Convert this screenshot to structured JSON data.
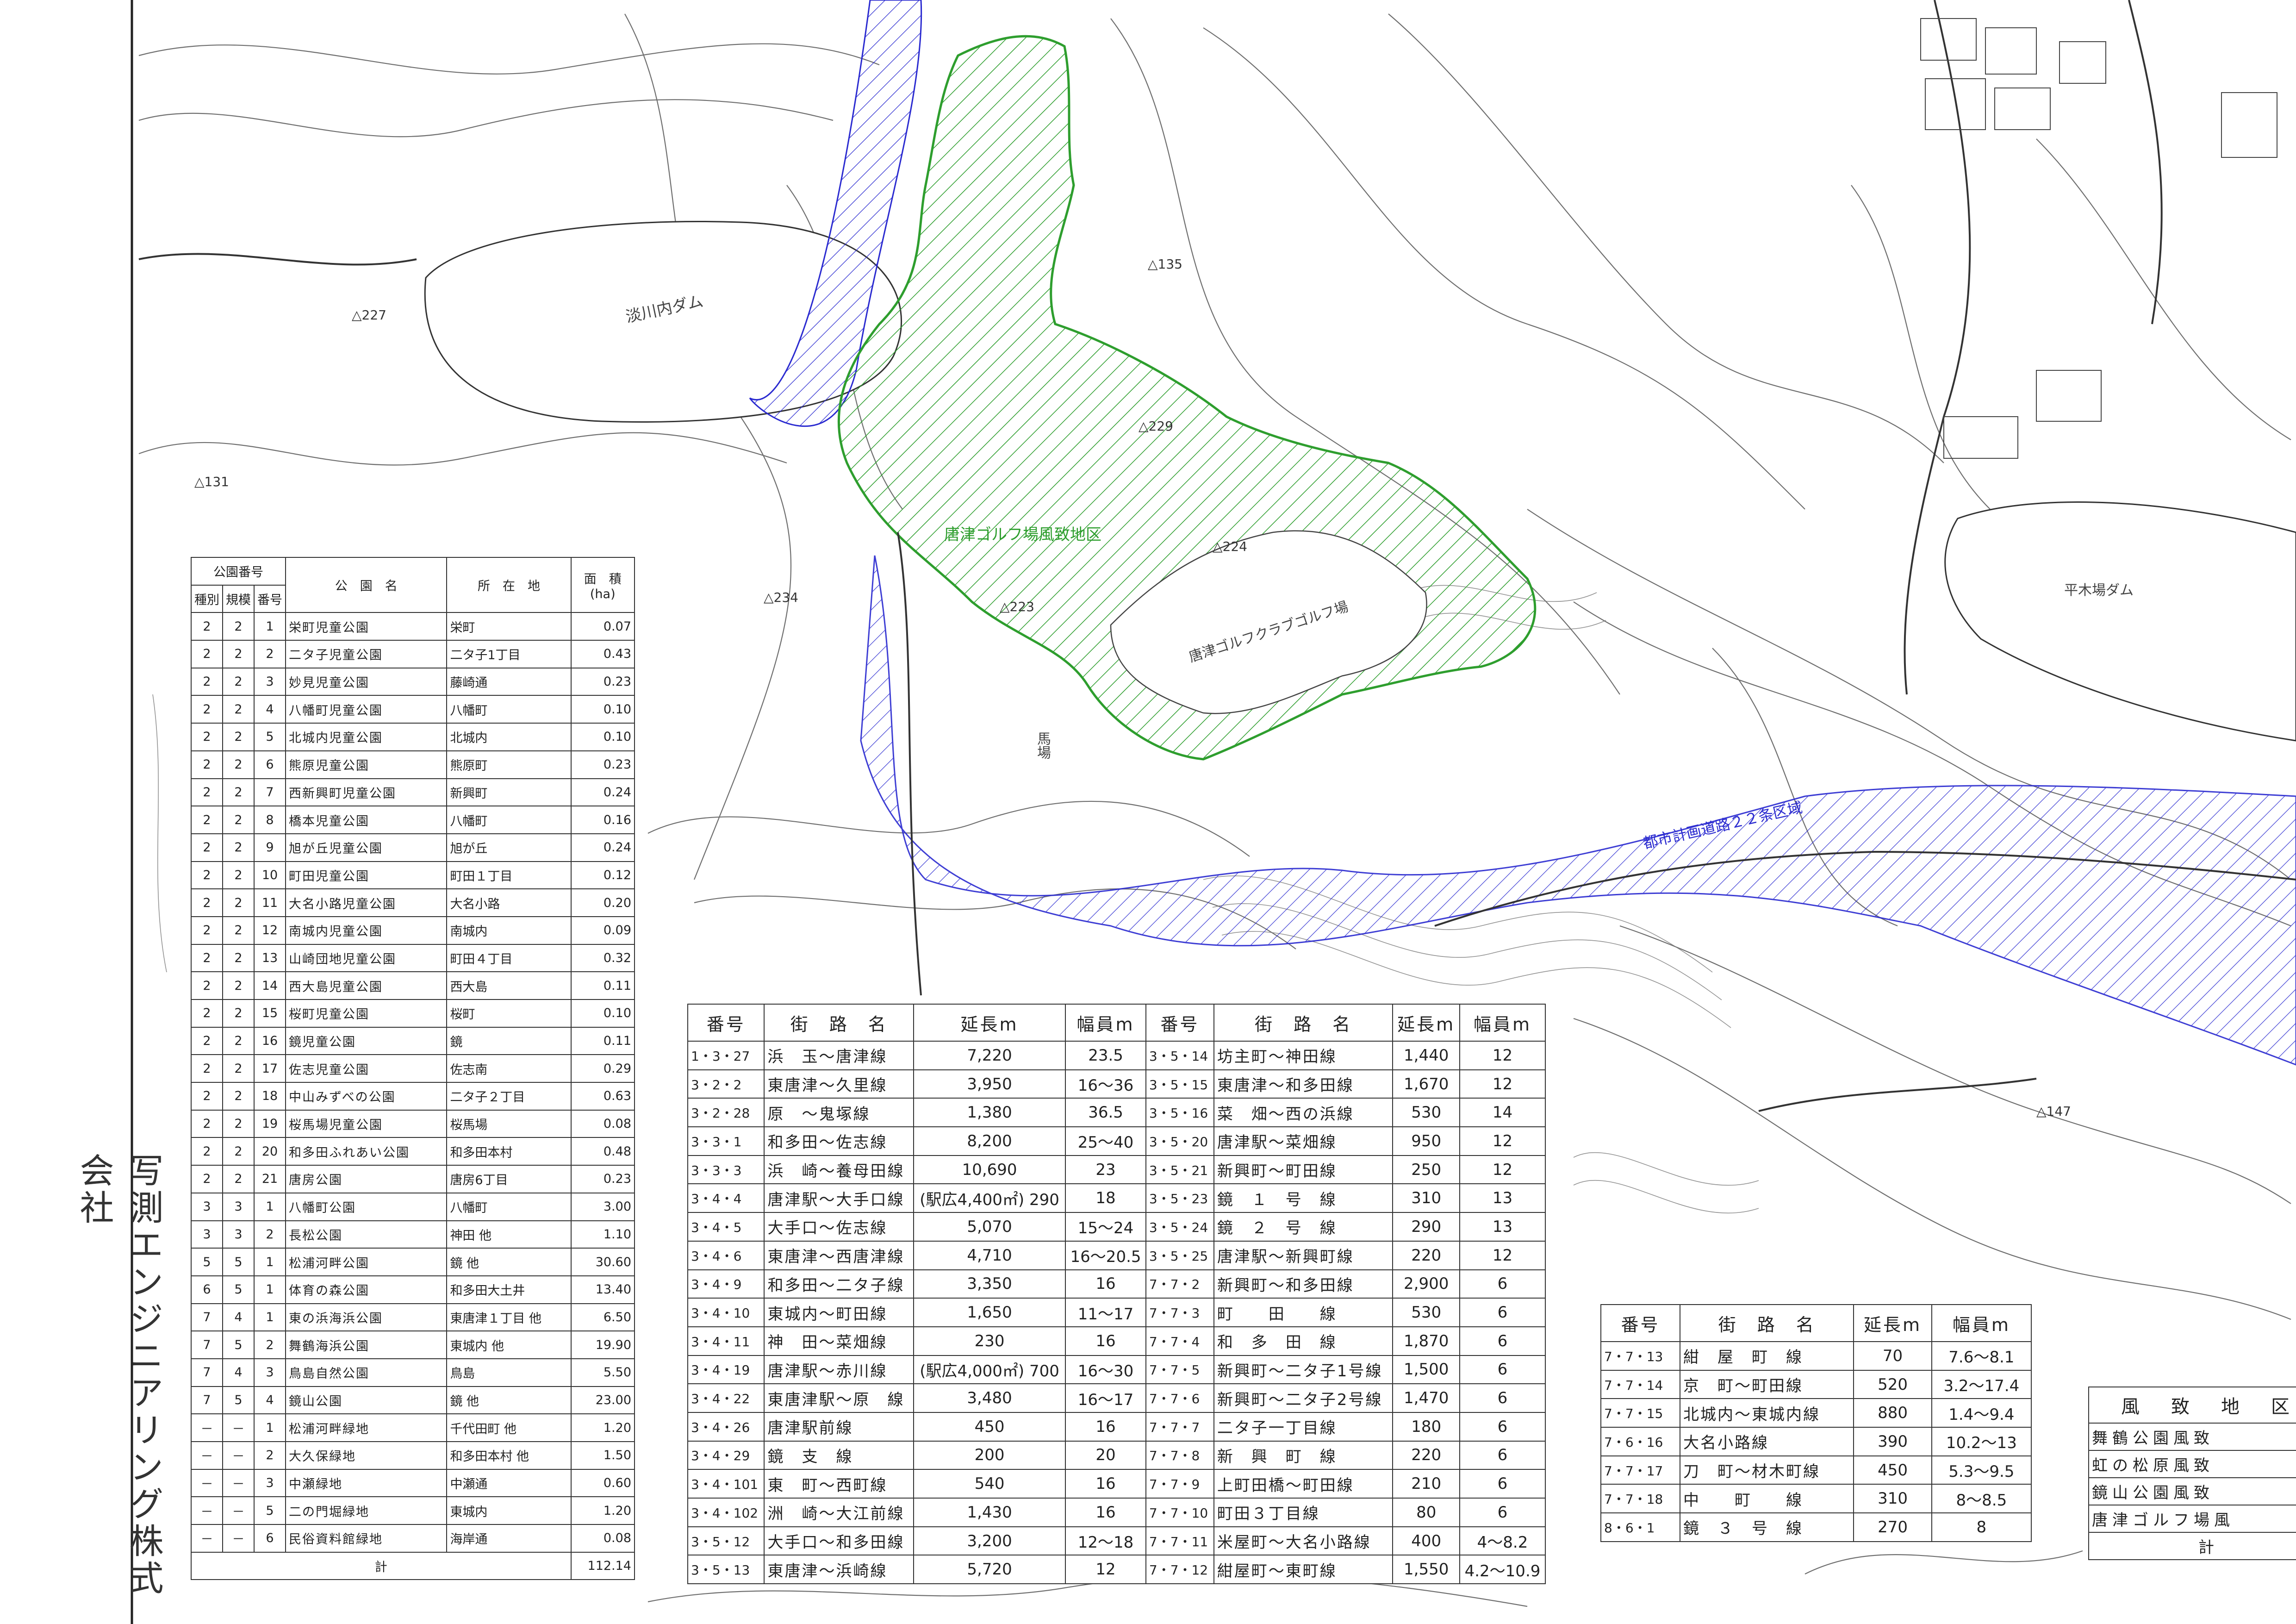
{
  "vertical_text": "写測エンジニアリング株式会社",
  "map_labels": {
    "golf_zone": "唐津ゴルフ場風致地区",
    "dam_left": "淡川内ダム",
    "dam_right": "平木場ダム",
    "golf_course": "唐津ゴルフクラブゴルフ場",
    "road_zone": "都市計画道路２２条区域",
    "horse_track": "馬場",
    "elevations": [
      "227",
      "223",
      "229",
      "224",
      "234",
      "131",
      "135",
      "147"
    ],
    "colors": {
      "golf_zone": "#2e9e2e",
      "road_zone": "#2a2ad0",
      "contour": "#555555"
    }
  },
  "park_table": {
    "header_group": "公園番号",
    "headers": {
      "type": "種別",
      "scale": "規模",
      "no": "番号",
      "name": "公　園　名",
      "location": "所　在　地",
      "area": "面　積",
      "area_unit": "(ha)"
    },
    "rows": [
      {
        "type": "2",
        "scale": "2",
        "no": "1",
        "name": "栄町児童公園",
        "loc": "栄町",
        "area": "0.07"
      },
      {
        "type": "2",
        "scale": "2",
        "no": "2",
        "name": "二タ子児童公園",
        "loc": "二タ子1丁目",
        "area": "0.43"
      },
      {
        "type": "2",
        "scale": "2",
        "no": "3",
        "name": "妙見児童公園",
        "loc": "藤崎通",
        "area": "0.23"
      },
      {
        "type": "2",
        "scale": "2",
        "no": "4",
        "name": "八幡町児童公園",
        "loc": "八幡町",
        "area": "0.10"
      },
      {
        "type": "2",
        "scale": "2",
        "no": "5",
        "name": "北城内児童公園",
        "loc": "北城内",
        "area": "0.10"
      },
      {
        "type": "2",
        "scale": "2",
        "no": "6",
        "name": "熊原児童公園",
        "loc": "熊原町",
        "area": "0.23"
      },
      {
        "type": "2",
        "scale": "2",
        "no": "7",
        "name": "西新興町児童公園",
        "loc": "新興町",
        "area": "0.24"
      },
      {
        "type": "2",
        "scale": "2",
        "no": "8",
        "name": "橋本児童公園",
        "loc": "八幡町",
        "area": "0.16"
      },
      {
        "type": "2",
        "scale": "2",
        "no": "9",
        "name": "旭が丘児童公園",
        "loc": "旭が丘",
        "area": "0.24"
      },
      {
        "type": "2",
        "scale": "2",
        "no": "10",
        "name": "町田児童公園",
        "loc": "町田１丁目",
        "area": "0.12"
      },
      {
        "type": "2",
        "scale": "2",
        "no": "11",
        "name": "大名小路児童公園",
        "loc": "大名小路",
        "area": "0.20"
      },
      {
        "type": "2",
        "scale": "2",
        "no": "12",
        "name": "南城内児童公園",
        "loc": "南城内",
        "area": "0.09"
      },
      {
        "type": "2",
        "scale": "2",
        "no": "13",
        "name": "山崎団地児童公園",
        "loc": "町田４丁目",
        "area": "0.32"
      },
      {
        "type": "2",
        "scale": "2",
        "no": "14",
        "name": "西大島児童公園",
        "loc": "西大島",
        "area": "0.11"
      },
      {
        "type": "2",
        "scale": "2",
        "no": "15",
        "name": "桜町児童公園",
        "loc": "桜町",
        "area": "0.10"
      },
      {
        "type": "2",
        "scale": "2",
        "no": "16",
        "name": "鏡児童公園",
        "loc": "鏡",
        "area": "0.11"
      },
      {
        "type": "2",
        "scale": "2",
        "no": "17",
        "name": "佐志児童公園",
        "loc": "佐志南",
        "area": "0.29"
      },
      {
        "type": "2",
        "scale": "2",
        "no": "18",
        "name": "中山みずべの公園",
        "loc": "二タ子２丁目",
        "area": "0.63"
      },
      {
        "type": "2",
        "scale": "2",
        "no": "19",
        "name": "桜馬場児童公園",
        "loc": "桜馬場",
        "area": "0.08"
      },
      {
        "type": "2",
        "scale": "2",
        "no": "20",
        "name": "和多田ふれあい公園",
        "loc": "和多田本村",
        "area": "0.48"
      },
      {
        "type": "2",
        "scale": "2",
        "no": "21",
        "name": "唐房公園",
        "loc": "唐房6丁目",
        "area": "0.23"
      },
      {
        "type": "3",
        "scale": "3",
        "no": "1",
        "name": "八幡町公園",
        "loc": "八幡町",
        "area": "3.00"
      },
      {
        "type": "3",
        "scale": "3",
        "no": "2",
        "name": "長松公園",
        "loc": "神田 他",
        "area": "1.10"
      },
      {
        "type": "5",
        "scale": "5",
        "no": "1",
        "name": "松浦河畔公園",
        "loc": "鏡 他",
        "area": "30.60"
      },
      {
        "type": "6",
        "scale": "5",
        "no": "1",
        "name": "体育の森公園",
        "loc": "和多田大土井",
        "area": "13.40"
      },
      {
        "type": "7",
        "scale": "4",
        "no": "1",
        "name": "東の浜海浜公園",
        "loc": "東唐津１丁目 他",
        "area": "6.50"
      },
      {
        "type": "7",
        "scale": "5",
        "no": "2",
        "name": "舞鶴海浜公園",
        "loc": "東城内 他",
        "area": "19.90"
      },
      {
        "type": "7",
        "scale": "4",
        "no": "3",
        "name": "鳥島自然公園",
        "loc": "鳥島",
        "area": "5.50"
      },
      {
        "type": "7",
        "scale": "5",
        "no": "4",
        "name": "鏡山公園",
        "loc": "鏡 他",
        "area": "23.00"
      },
      {
        "type": "－",
        "scale": "－",
        "no": "1",
        "name": "松浦河畔緑地",
        "loc": "千代田町 他",
        "area": "1.20"
      },
      {
        "type": "－",
        "scale": "－",
        "no": "2",
        "name": "大久保緑地",
        "loc": "和多田本村 他",
        "area": "1.50"
      },
      {
        "type": "－",
        "scale": "－",
        "no": "3",
        "name": "中瀬緑地",
        "loc": "中瀬通",
        "area": "0.60"
      },
      {
        "type": "－",
        "scale": "－",
        "no": "5",
        "name": "二の門堀緑地",
        "loc": "東城内",
        "area": "1.20"
      },
      {
        "type": "－",
        "scale": "－",
        "no": "6",
        "name": "民俗資料館緑地",
        "loc": "海岸通",
        "area": "0.08"
      }
    ],
    "total_label": "計",
    "total_area": "112.14"
  },
  "road_table_a": {
    "headers": {
      "code": "番号",
      "name": "街　路　名",
      "length": "延長m",
      "width": "幅員m"
    },
    "left_rows": [
      {
        "code": "1・3・27",
        "name": "浜　玉～唐津線",
        "len": "7,220",
        "wid": "23.5"
      },
      {
        "code": "3・2・2",
        "name": "東唐津～久里線",
        "len": "3,950",
        "wid": "16～36"
      },
      {
        "code": "3・2・28",
        "name": "原　～鬼塚線",
        "len": "1,380",
        "wid": "36.5"
      },
      {
        "code": "3・3・1",
        "name": "和多田～佐志線",
        "len": "8,200",
        "wid": "25～40"
      },
      {
        "code": "3・3・3",
        "name": "浜　崎～養母田線",
        "len": "10,690",
        "wid": "23"
      },
      {
        "code": "3・4・4",
        "name": "唐津駅～大手口線",
        "len": "(駅広4,400㎡) 290",
        "wid": "18"
      },
      {
        "code": "3・4・5",
        "name": "大手口～佐志線",
        "len": "5,070",
        "wid": "15～24"
      },
      {
        "code": "3・4・6",
        "name": "東唐津～西唐津線",
        "len": "4,710",
        "wid": "16～20.5"
      },
      {
        "code": "3・4・9",
        "name": "和多田～二タ子線",
        "len": "3,350",
        "wid": "16"
      },
      {
        "code": "3・4・10",
        "name": "東城内～町田線",
        "len": "1,650",
        "wid": "11～17"
      },
      {
        "code": "3・4・11",
        "name": "神　田～菜畑線",
        "len": "230",
        "wid": "16"
      },
      {
        "code": "3・4・19",
        "name": "唐津駅～赤川線",
        "len": "(駅広4,000㎡) 700",
        "wid": "16～30"
      },
      {
        "code": "3・4・22",
        "name": "東唐津駅～原　線",
        "len": "3,480",
        "wid": "16～17"
      },
      {
        "code": "3・4・26",
        "name": "唐津駅前線",
        "len": "450",
        "wid": "16"
      },
      {
        "code": "3・4・29",
        "name": "鏡　支　線",
        "len": "200",
        "wid": "20"
      },
      {
        "code": "3・4・101",
        "name": "東　町～西町線",
        "len": "540",
        "wid": "16"
      },
      {
        "code": "3・4・102",
        "name": "洲　崎～大江前線",
        "len": "1,430",
        "wid": "16"
      },
      {
        "code": "3・5・12",
        "name": "大手口～和多田線",
        "len": "3,200",
        "wid": "12～18"
      },
      {
        "code": "3・5・13",
        "name": "東唐津～浜崎線",
        "len": "5,720",
        "wid": "12"
      }
    ],
    "right_rows": [
      {
        "code": "3・5・14",
        "name": "坊主町～神田線",
        "len": "1,440",
        "wid": "12"
      },
      {
        "code": "3・5・15",
        "name": "東唐津～和多田線",
        "len": "1,670",
        "wid": "12"
      },
      {
        "code": "3・5・16",
        "name": "菜　畑～西の浜線",
        "len": "530",
        "wid": "14"
      },
      {
        "code": "3・5・20",
        "name": "唐津駅～菜畑線",
        "len": "950",
        "wid": "12"
      },
      {
        "code": "3・5・21",
        "name": "新興町～町田線",
        "len": "250",
        "wid": "12"
      },
      {
        "code": "3・5・23",
        "name": "鏡　１　号　線",
        "len": "310",
        "wid": "13"
      },
      {
        "code": "3・5・24",
        "name": "鏡　２　号　線",
        "len": "290",
        "wid": "13"
      },
      {
        "code": "3・5・25",
        "name": "唐津駅～新興町線",
        "len": "220",
        "wid": "12"
      },
      {
        "code": "7・7・2",
        "name": "新興町～和多田線",
        "len": "2,900",
        "wid": "6"
      },
      {
        "code": "7・7・3",
        "name": "町　　田　　線",
        "len": "530",
        "wid": "6"
      },
      {
        "code": "7・7・4",
        "name": "和　多　田　線",
        "len": "1,870",
        "wid": "6"
      },
      {
        "code": "7・7・5",
        "name": "新興町～二タ子1号線",
        "len": "1,500",
        "wid": "6"
      },
      {
        "code": "7・7・6",
        "name": "新興町～二タ子2号線",
        "len": "1,470",
        "wid": "6"
      },
      {
        "code": "7・7・7",
        "name": "二タ子一丁目線",
        "len": "180",
        "wid": "6"
      },
      {
        "code": "7・7・8",
        "name": "新　興　町　線",
        "len": "220",
        "wid": "6"
      },
      {
        "code": "7・7・9",
        "name": "上町田橋～町田線",
        "len": "210",
        "wid": "6"
      },
      {
        "code": "7・7・10",
        "name": "町田３丁目線",
        "len": "80",
        "wid": "6"
      },
      {
        "code": "7・7・11",
        "name": "米屋町～大名小路線",
        "len": "400",
        "wid": "4～8.2"
      },
      {
        "code": "7・7・12",
        "name": "紺屋町～東町線",
        "len": "1,550",
        "wid": "4.2～10.9"
      }
    ]
  },
  "road_table_b": {
    "headers": {
      "code": "番号",
      "name": "街　路　名",
      "length": "延長m",
      "width": "幅員m"
    },
    "rows": [
      {
        "code": "7・7・13",
        "name": "紺　屋　町　線",
        "len": "70",
        "wid": "7.6～8.1"
      },
      {
        "code": "7・7・14",
        "name": "京　町～町田線",
        "len": "520",
        "wid": "3.2～17.4"
      },
      {
        "code": "7・7・15",
        "name": "北城内～東城内線",
        "len": "880",
        "wid": "1.4～9.4"
      },
      {
        "code": "7・6・16",
        "name": "大名小路線",
        "len": "390",
        "wid": "10.2～13"
      },
      {
        "code": "7・7・17",
        "name": "刀　町～材木町線",
        "len": "450",
        "wid": "5.3～9.5"
      },
      {
        "code": "7・7・18",
        "name": "中　　町　　線",
        "len": "310",
        "wid": "8～8.5"
      },
      {
        "code": "8・6・1",
        "name": "鏡　３　号　線",
        "len": "270",
        "wid": "8"
      }
    ]
  },
  "scenic_table": {
    "header": "風　致　地　区",
    "rows": [
      "舞鶴公園風致",
      "虹の松原風致",
      "鏡山公園風致",
      "唐津ゴルフ場風"
    ],
    "total_label": "計"
  }
}
